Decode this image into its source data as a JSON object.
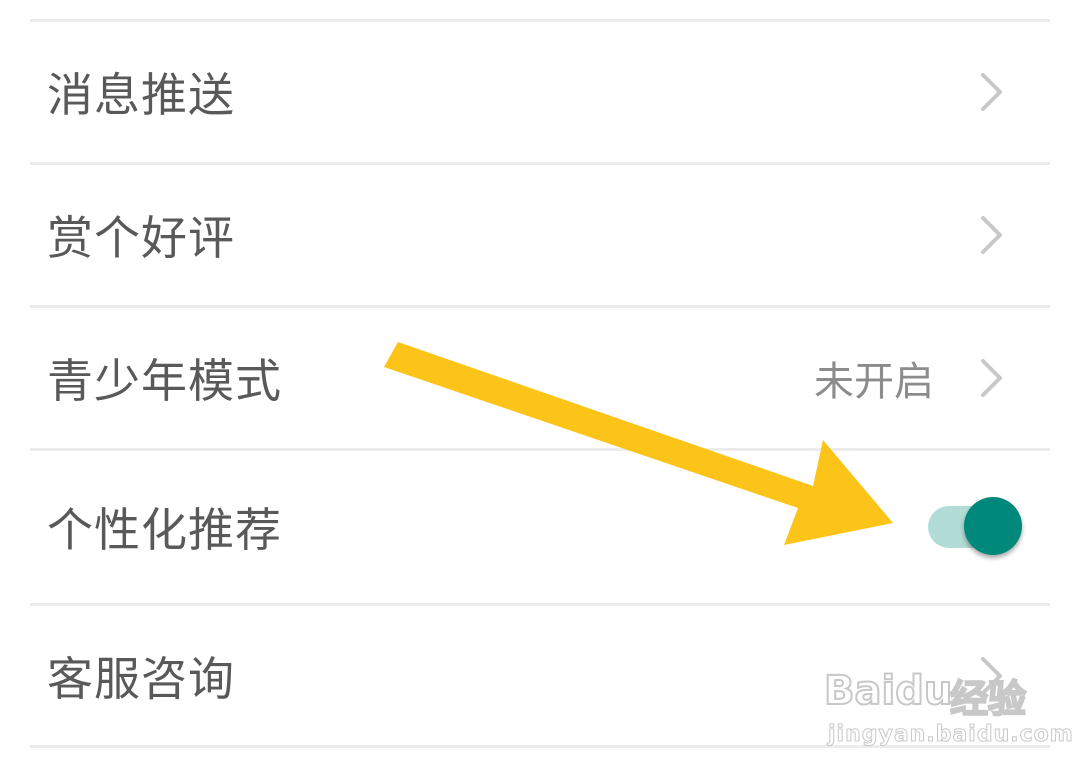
{
  "settings": {
    "items": [
      {
        "label": "消息推送",
        "value": "",
        "control": "chevron"
      },
      {
        "label": "赏个好评",
        "value": "",
        "control": "chevron"
      },
      {
        "label": "青少年模式",
        "value": "未开启",
        "control": "chevron"
      },
      {
        "label": "个性化推荐",
        "value": "",
        "control": "toggle",
        "toggle_on": true
      },
      {
        "label": "客服咨询",
        "value": "",
        "control": "chevron"
      }
    ]
  },
  "annotation": {
    "arrow_color": "#fcc419",
    "description_icon": "arrow-pointer-icon"
  },
  "watermark": {
    "brand": "Baidu",
    "brand_cn": "经验",
    "url": "jingyan.baidu.com"
  },
  "colors": {
    "label_text": "#595959",
    "value_text": "#8c8c8c",
    "divider": "#ececec",
    "chevron": "#c8c8c8",
    "toggle_track": "#b2dcd6",
    "toggle_knob": "#00897b"
  }
}
